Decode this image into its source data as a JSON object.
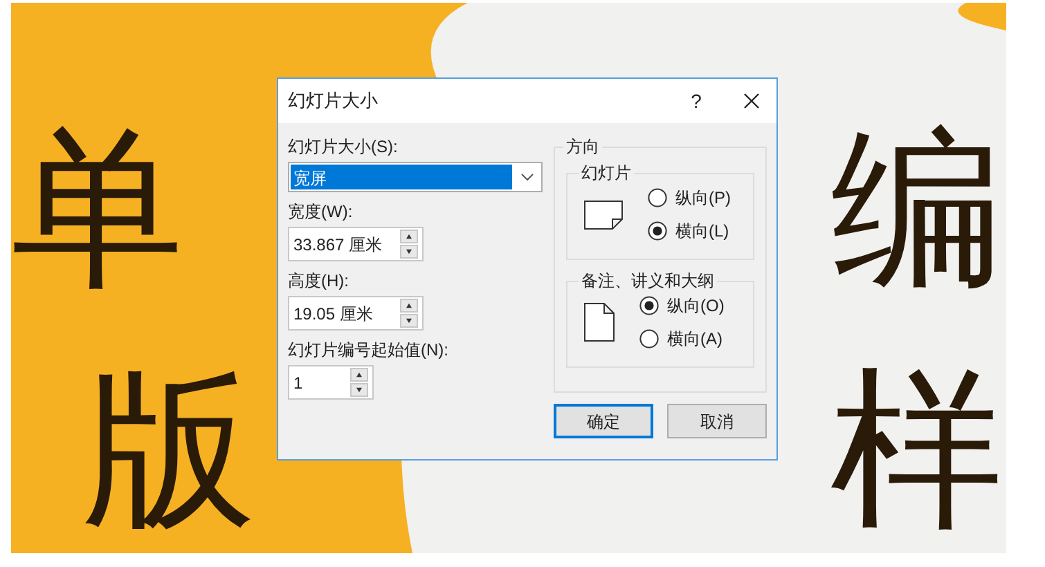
{
  "slide": {
    "title_line_1": [
      "单",
      "编"
    ],
    "title_line_2": [
      "版",
      "样"
    ]
  },
  "dialog": {
    "title": "幻灯片大小",
    "help": "?",
    "size_label": "幻灯片大小(S):",
    "size_select": {
      "value": "宽屏"
    },
    "fields": [
      {
        "label": "宽度(W):",
        "value": "33.867 厘米",
        "kind": "wide"
      },
      {
        "label": "高度(H):",
        "value": "19.05 厘米",
        "kind": "wide"
      },
      {
        "label": "幻灯片编号起始值(N):",
        "value": "1",
        "kind": "narrow"
      }
    ],
    "orientation": {
      "title": "方向",
      "groups": [
        {
          "title": "幻灯片",
          "kind": "landscape",
          "options": [
            {
              "label": "纵向(P)",
              "selected": false
            },
            {
              "label": "横向(L)",
              "selected": true
            }
          ]
        },
        {
          "title": "备注、讲义和大纲",
          "kind": "portrait",
          "options": [
            {
              "label": "纵向(O)",
              "selected": true
            },
            {
              "label": "横向(A)",
              "selected": false
            }
          ]
        }
      ]
    },
    "buttons": [
      {
        "label": "确定",
        "default": true
      },
      {
        "label": "取消",
        "default": false
      }
    ]
  }
}
